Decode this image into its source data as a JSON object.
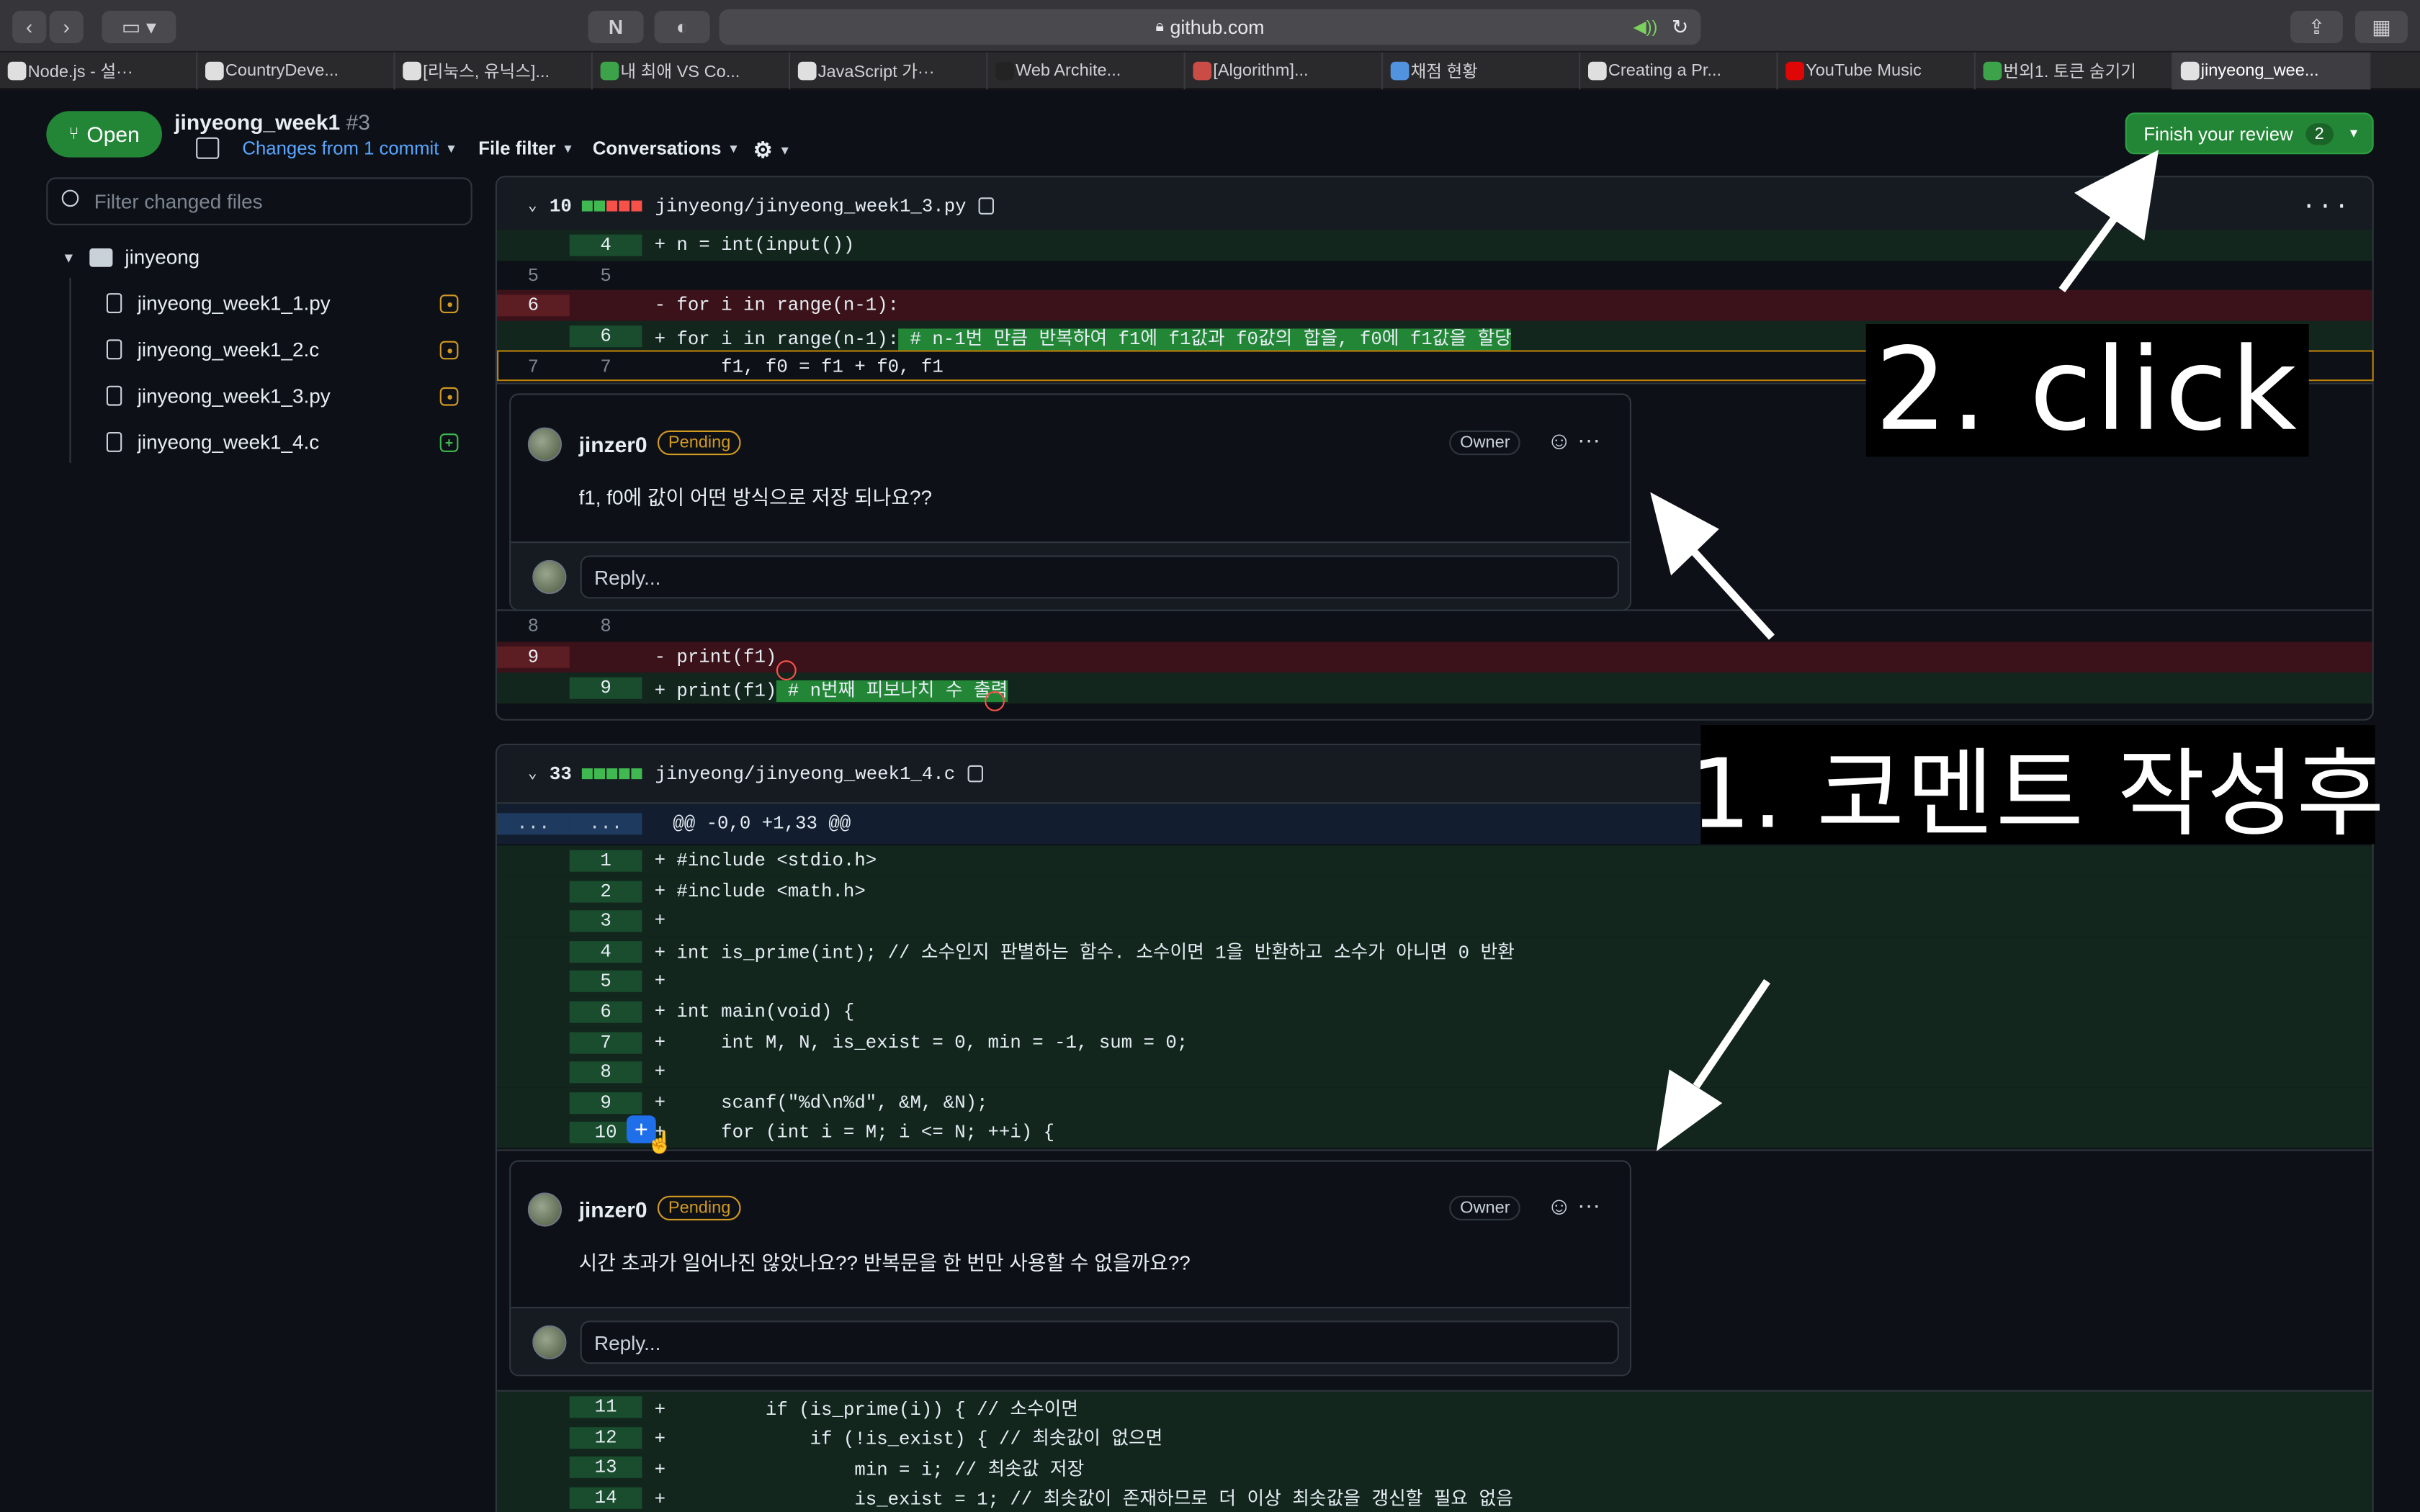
{
  "browser": {
    "url": "github.com",
    "tabs": [
      "Node.js - 설···",
      "CountryDeve...",
      "[리눅스, 유닉스]...",
      "내 최애 VS Co...",
      "JavaScript 가···",
      "Web Archite...",
      "[Algorithm]...",
      "채점 현황",
      "Creating a Pr...",
      "YouTube Music",
      "번외1. 토큰 숨기기",
      "jinyeong_wee..."
    ]
  },
  "pr": {
    "state": "Open",
    "title": "jinyeong_week1",
    "number": "#3",
    "changes": "Changes from 1 commit",
    "file_filter": "File filter",
    "conversations": "Conversations",
    "finish_label": "Finish your review",
    "finish_count": "2"
  },
  "sidebar": {
    "filter_placeholder": "Filter changed files",
    "folder": "jinyeong",
    "files": [
      "jinyeong_week1_1.py",
      "jinyeong_week1_2.c",
      "jinyeong_week1_3.py",
      "jinyeong_week1_4.c"
    ]
  },
  "file1": {
    "count": "10",
    "path": "jinyeong/jinyeong_week1_3.py",
    "lines": [
      {
        "type": "add",
        "o": "",
        "n": "4",
        "code": "+ n = int(input())"
      },
      {
        "type": "ctx",
        "o": "5",
        "n": "5",
        "code": ""
      },
      {
        "type": "del",
        "o": "6",
        "n": "",
        "code": "- for i in range(n-1):"
      },
      {
        "type": "add",
        "o": "",
        "n": "6",
        "code": "+ for i in range(n-1):",
        "hl": " # n-1번 만큼 반복하여 f1에 f1값과 f0값의 합을, f0에 f1값을 할당"
      },
      {
        "type": "ctx",
        "o": "7",
        "n": "7",
        "code": "      f1, f0 = f1 + f0, f1"
      },
      {
        "type": "ctx",
        "o": "8",
        "n": "8",
        "code": ""
      },
      {
        "type": "del",
        "o": "9",
        "n": "",
        "code": "- print(f1)"
      },
      {
        "type": "add",
        "o": "",
        "n": "9",
        "code": "+ print(f1)",
        "hl": " # n번째 피보나치 수 출력"
      }
    ]
  },
  "file2": {
    "count": "33",
    "path": "jinyeong/jinyeong_week1_4.c",
    "hunk": "@@ -0,0 +1,33 @@",
    "hunk_ln": "...",
    "lines": [
      {
        "n": "1",
        "code": "+ #include <stdio.h>"
      },
      {
        "n": "2",
        "code": "+ #include <math.h>"
      },
      {
        "n": "3",
        "code": "+"
      },
      {
        "n": "4",
        "code": "+ int is_prime(int); // 소수인지 판별하는 함수. 소수이면 1을 반환하고 소수가 아니면 0 반환"
      },
      {
        "n": "5",
        "code": "+"
      },
      {
        "n": "6",
        "code": "+ int main(void) {"
      },
      {
        "n": "7",
        "code": "+     int M, N, is_exist = 0, min = -1, sum = 0;"
      },
      {
        "n": "8",
        "code": "+"
      },
      {
        "n": "9",
        "code": "+     scanf(\"%d\\n%d\", &M, &N);"
      },
      {
        "n": "10",
        "code": "+     for (int i = M; i <= N; ++i) {"
      }
    ],
    "lines_after": [
      {
        "n": "11",
        "code": "+         if (is_prime(i)) { // 소수이면"
      },
      {
        "n": "12",
        "code": "+             if (!is_exist) { // 최솟값이 없으면"
      },
      {
        "n": "13",
        "code": "+                 min = i; // 최솟값 저장"
      },
      {
        "n": "14",
        "code": "+                 is_exist = 1; // 최솟값이 존재하므로 더 이상 최솟값을 갱신할 필요 없음"
      }
    ]
  },
  "comments": [
    {
      "author": "jinzer0",
      "status": "Pending",
      "role": "Owner",
      "body": "f1, f0에 값이 어떤 방식으로 저장 되나요??",
      "reply": "Reply..."
    },
    {
      "author": "jinzer0",
      "status": "Pending",
      "role": "Owner",
      "body": "시간 초과가 일어나진 않았나요?? 반복문을 한 번만 사용할 수 없을까요??",
      "reply": "Reply..."
    }
  ],
  "annotations": {
    "step2": "2. click",
    "step1": "1. 코멘트 작성후"
  },
  "colors": {
    "accent_green": "#238636",
    "pending": "#d29922",
    "link": "#58a6ff"
  },
  "icons": [
    "back-icon",
    "forward-icon",
    "sidebar-icon",
    "notion-icon",
    "shield-icon",
    "lock-icon",
    "reload-icon",
    "share-icon",
    "tabs-grid-icon",
    "pr-icon",
    "search-icon",
    "folder-icon",
    "file-icon",
    "copy-icon",
    "gear-icon",
    "emoji-icon",
    "kebab-icon",
    "plus-icon"
  ]
}
